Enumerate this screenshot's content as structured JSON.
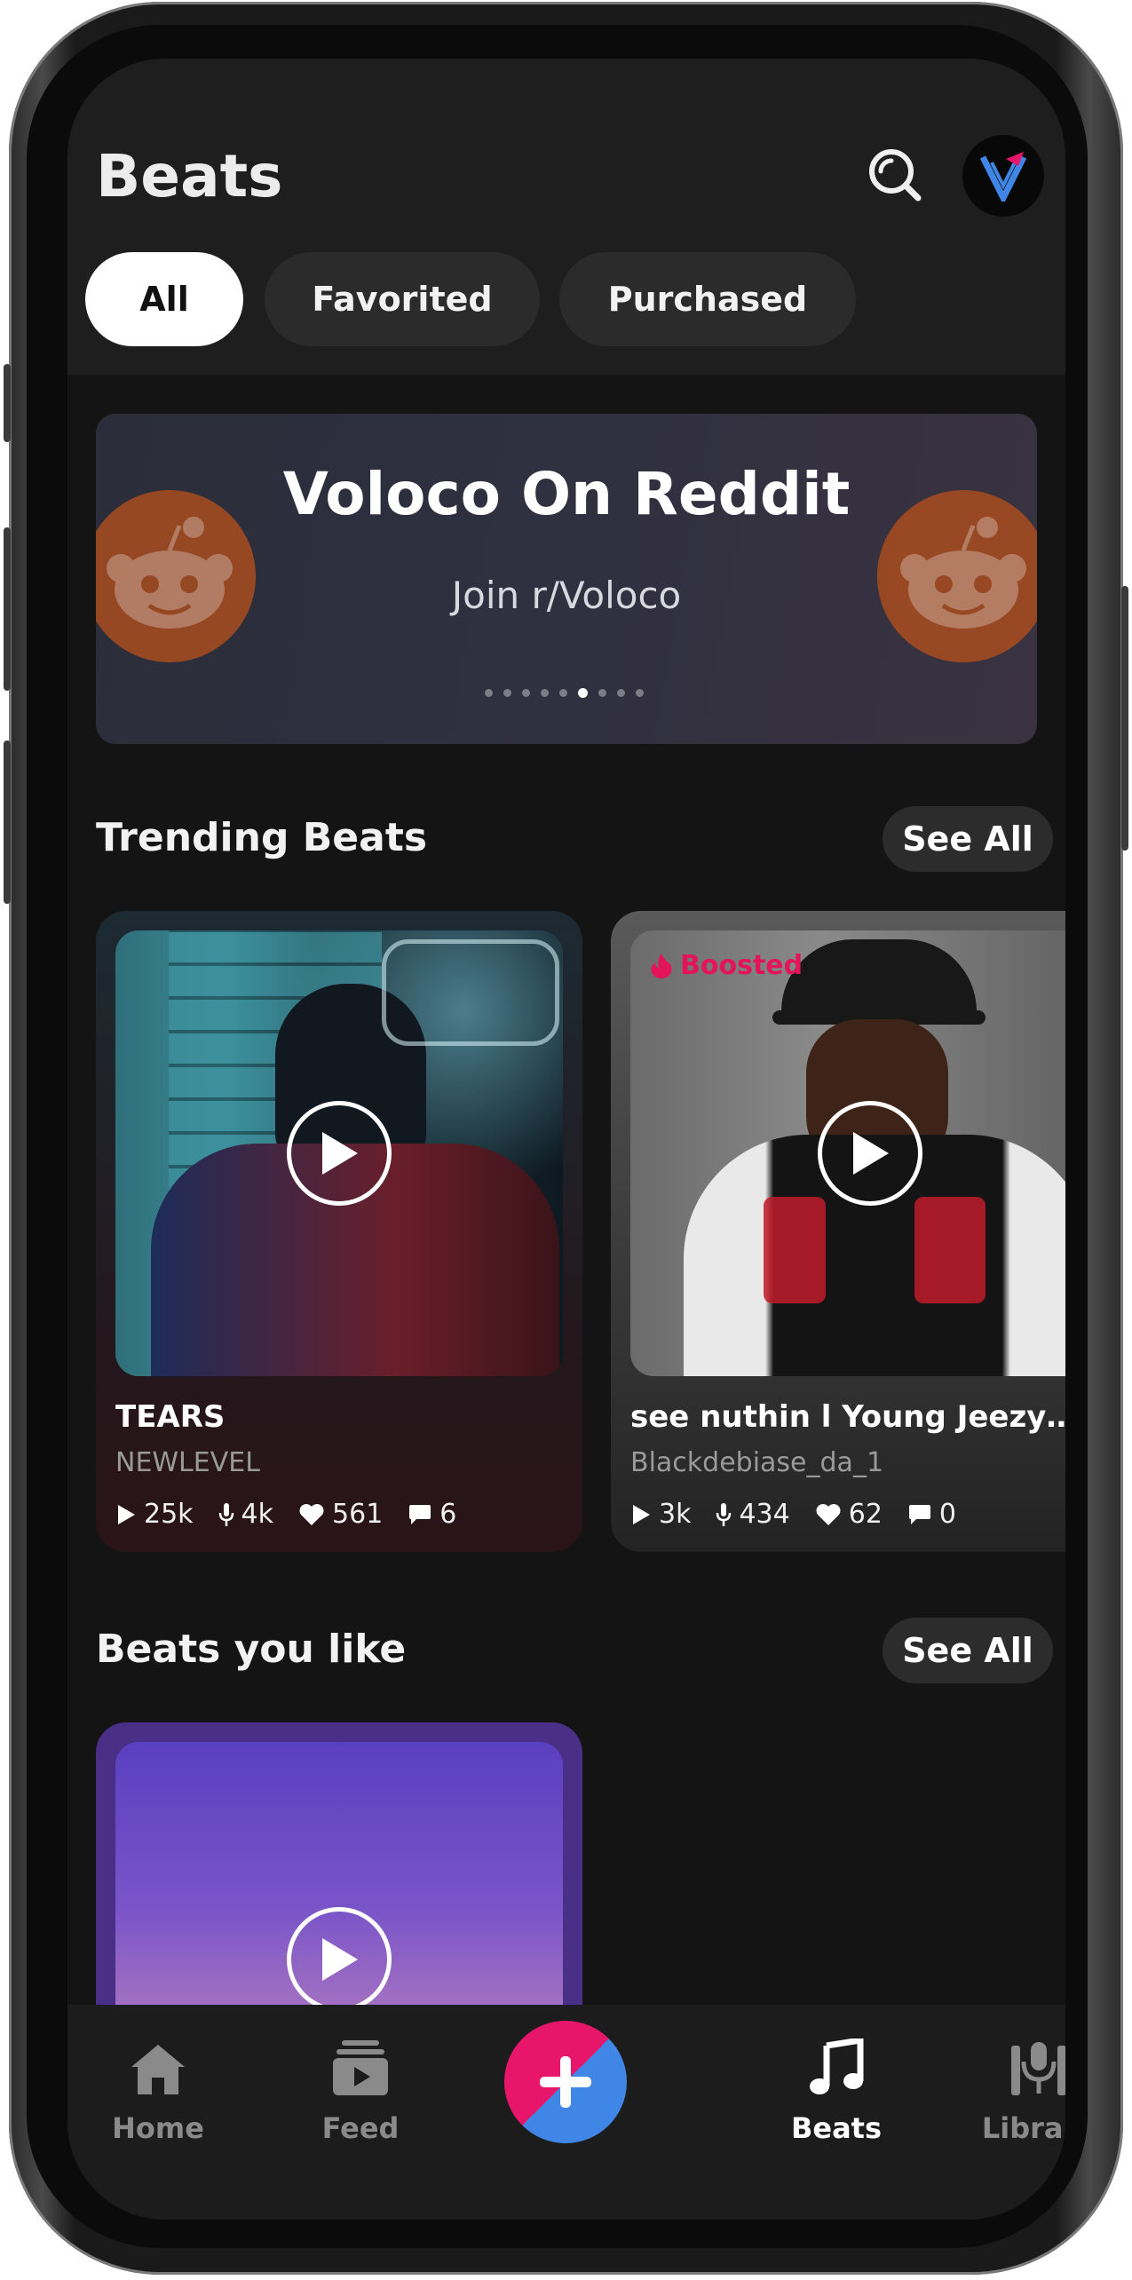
{
  "header": {
    "title": "Beats",
    "search_icon": "search-icon",
    "avatar_icon": "voloco-logo-icon"
  },
  "filters": [
    {
      "label": "All",
      "active": true
    },
    {
      "label": "Favorited",
      "active": false
    },
    {
      "label": "Purchased",
      "active": false
    }
  ],
  "banner": {
    "title": "Voloco On Reddit",
    "subtitle": "Join r/Voloco",
    "icon": "reddit-icon",
    "page_count": 9,
    "active_page": 6
  },
  "trending": {
    "title": "Trending Beats",
    "see_all": "See All",
    "items": [
      {
        "title": "TEARS",
        "artist": "NEWLEVEL",
        "plays": "25k",
        "recordings": "4k",
        "likes": "561",
        "comments": "6",
        "boosted": false
      },
      {
        "title": "see nuthin l Young Jeezy Typ...",
        "artist": "Blackdebiase_da_1",
        "plays": "3k",
        "recordings": "434",
        "likes": "62",
        "comments": "0",
        "boosted": true,
        "boosted_label": "Boosted"
      }
    ]
  },
  "liked": {
    "title": "Beats you like",
    "see_all": "See All"
  },
  "nav": {
    "items": [
      {
        "label": "Home",
        "icon": "home-icon",
        "active": false
      },
      {
        "label": "Feed",
        "icon": "feed-icon",
        "active": false
      },
      {
        "label": "Beats",
        "icon": "music-note-icon",
        "active": true
      },
      {
        "label": "Library",
        "icon": "library-icon",
        "active": false
      }
    ],
    "create_icon": "plus-icon"
  },
  "colors": {
    "accent_pink": "#e8166b",
    "accent_blue": "#3f86e6",
    "background": "#141414"
  }
}
